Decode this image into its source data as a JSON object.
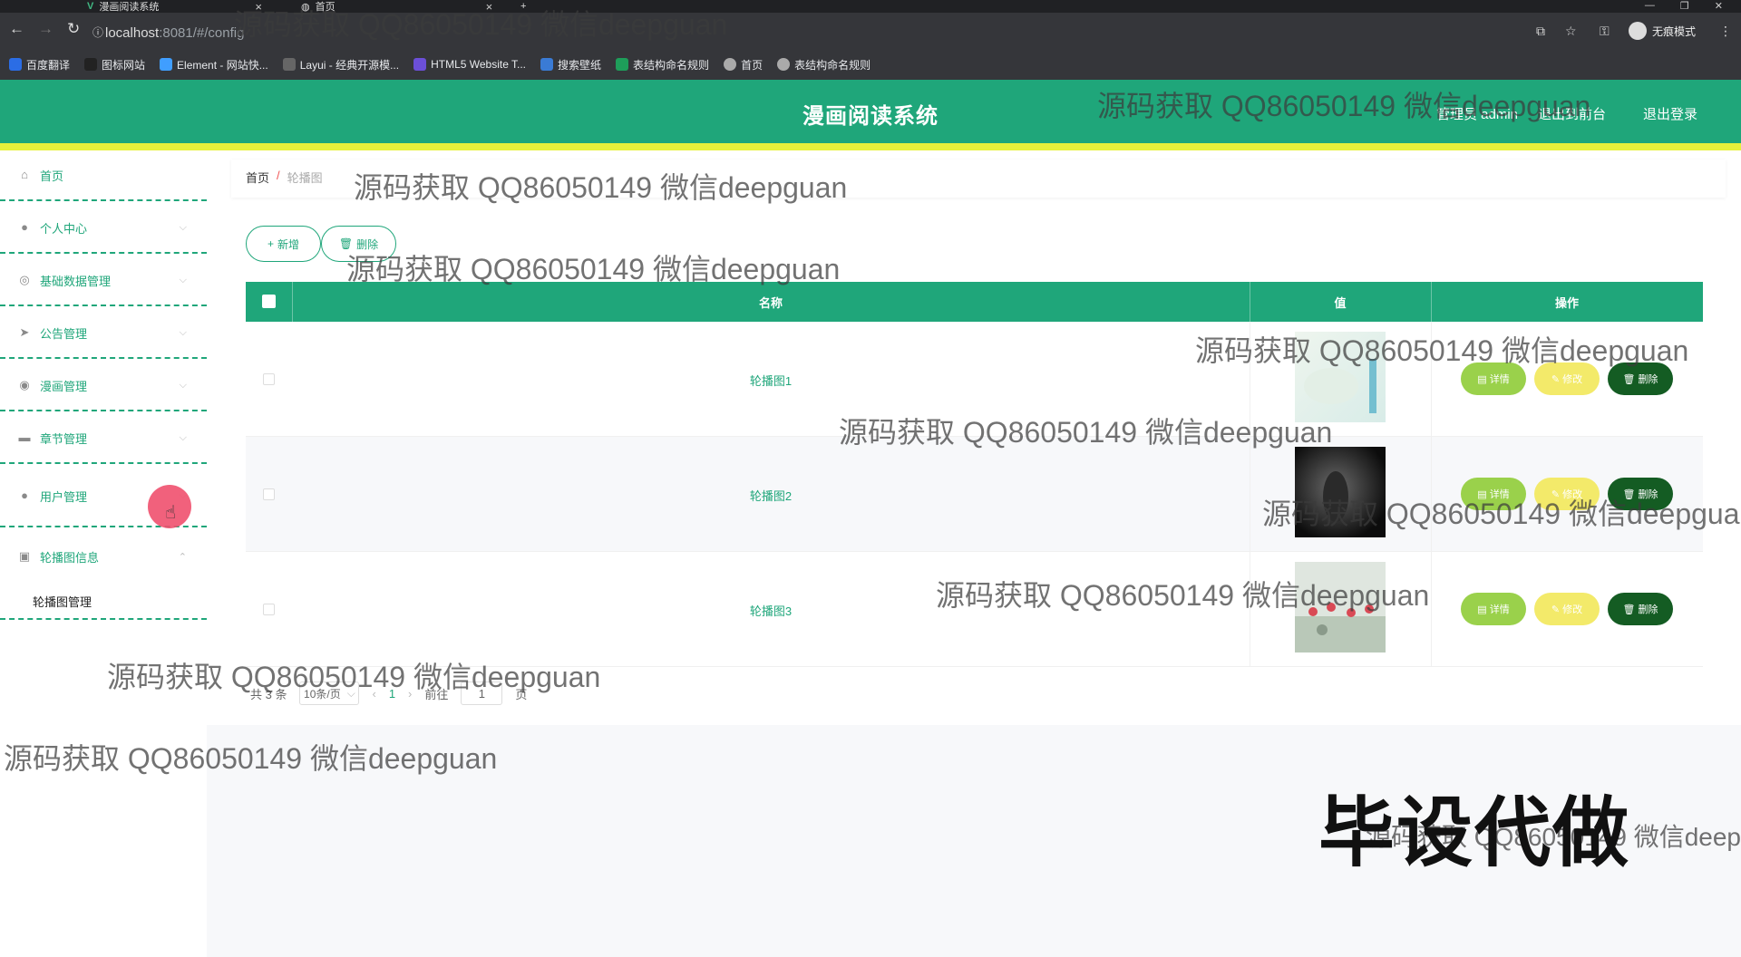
{
  "browser": {
    "tabs": [
      {
        "title": "漫画阅读系统",
        "active": true
      },
      {
        "title": "首页",
        "active": false
      }
    ],
    "url_host": "localhost",
    "url_rest": ":8081/#/config",
    "profile_label": "无痕模式",
    "bookmarks": [
      {
        "label": "百度翻译",
        "color": "#2b6de5"
      },
      {
        "label": "图标网站",
        "color": "#444"
      },
      {
        "label": "Element - 网站快...",
        "color": "#409eff"
      },
      {
        "label": "Layui - 经典开源模...",
        "color": "#666"
      },
      {
        "label": "HTML5 Website T...",
        "color": "#6b4fd8"
      },
      {
        "label": "搜索壁纸",
        "color": "#3a7bd5"
      },
      {
        "label": "表结构命名规则",
        "color": "#1e9e5a"
      },
      {
        "label": "首页",
        "color": "#aaa"
      },
      {
        "label": "表结构命名规则",
        "color": "#aaa"
      }
    ]
  },
  "header": {
    "title": "漫画阅读系统",
    "user_label": "管理员 admin",
    "back_label": "退出到前台",
    "logout_label": "退出登录",
    "brand_color": "#1fa67a",
    "accent_color": "#e8f03a"
  },
  "sidebar": {
    "items": [
      {
        "label": "首页",
        "icon": "home-icon"
      },
      {
        "label": "个人中心",
        "icon": "user-icon"
      },
      {
        "label": "基础数据管理",
        "icon": "settings-icon"
      },
      {
        "label": "公告管理",
        "icon": "send-icon"
      },
      {
        "label": "漫画管理",
        "icon": "compass-icon"
      },
      {
        "label": "章节管理",
        "icon": "chat-icon"
      },
      {
        "label": "用户管理",
        "icon": "user-icon"
      },
      {
        "label": "轮播图信息",
        "icon": "camera-icon"
      }
    ],
    "sub_item": "轮播图管理"
  },
  "breadcrumb": {
    "home": "首页",
    "separator": "/",
    "current": "轮播图"
  },
  "toolbar": {
    "add_label": "新增",
    "delete_label": "删除"
  },
  "table": {
    "columns": [
      "名称",
      "值",
      "操作"
    ],
    "rows": [
      {
        "name": "轮播图1",
        "thumb": "light"
      },
      {
        "name": "轮播图2",
        "thumb": "dark"
      },
      {
        "name": "轮播图3",
        "thumb": "flowers"
      }
    ],
    "actions": {
      "detail": "详情",
      "edit": "修改",
      "delete": "删除"
    }
  },
  "pagination": {
    "total": "共 3 条",
    "page_size": "10条/页",
    "current_page": "1",
    "goto_prefix": "前往",
    "goto_value": "1",
    "goto_suffix": "页"
  },
  "watermarks": {
    "text": "源码获取 QQ86050149 微信deepguan",
    "big_text": "毕设代做"
  }
}
